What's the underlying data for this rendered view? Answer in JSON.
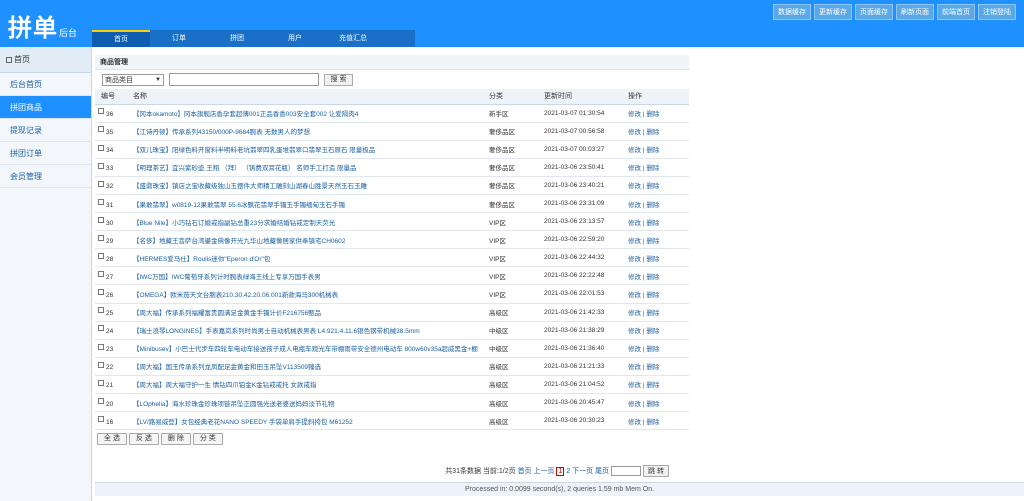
{
  "brand": {
    "logo_big": "拼单",
    "logo_small": "后台"
  },
  "quick_links": [
    "数据缓存",
    "更新缓存",
    "页面缓存",
    "刷新页面",
    "前端首页",
    "注销登陆"
  ],
  "main_nav": [
    {
      "label": "首页",
      "active": true
    },
    {
      "label": "订单",
      "active": false
    },
    {
      "label": "拼团",
      "active": false
    },
    {
      "label": "用户",
      "active": false
    },
    {
      "label": "充值汇总",
      "active": false
    }
  ],
  "sidebar": {
    "title": "首页",
    "items": [
      {
        "label": "后台首页",
        "active": false
      },
      {
        "label": "拼团商品",
        "active": true
      },
      {
        "label": "提现记录",
        "active": false
      },
      {
        "label": "拼团订单",
        "active": false
      },
      {
        "label": "会员管理",
        "active": false
      }
    ]
  },
  "panel": {
    "title": "商品管理",
    "category_select": "商品类目",
    "search_button": "搜 索",
    "headers": [
      "编号",
      "名称",
      "分类",
      "更新时间",
      "操作"
    ],
    "edit_label": "修改",
    "sep": "|",
    "delete_label": "删除",
    "rows": [
      {
        "id": "36",
        "name": "【冈本okamoto】冈本旗舰店香孕套超薄001正品香香003安全套002 让爱隔肉4",
        "cat": "新手区",
        "time": "2021-03-07 01:30:54"
      },
      {
        "id": "35",
        "name": "【江诗丹顿】传承系列43150/000P-9684腕表 无数男人的梦想",
        "cat": "奢侈品区",
        "time": "2021-03-07 00:56:58"
      },
      {
        "id": "34",
        "name": "【双儿珠宝】阳绿色料开窗料半明料老坑翡翠四乳蛋堆翡翠口翡翠玉石原石 限量极品",
        "cat": "奢侈品区",
        "time": "2021-03-07 00:03:27"
      },
      {
        "id": "33",
        "name": "【明理茶艺】宜兴紫砂壶 王翔 （拜） （铸费双耳花瓶） 名师手工打造 限量品",
        "cat": "奢侈品区",
        "time": "2021-03-06 23:50:41"
      },
      {
        "id": "32",
        "name": "【盛鼎珠宝】镇店之宝收藏级独山玉摆件大师精工雕刻山湖春山胜景天然玉石玉雕",
        "cat": "奢侈品区",
        "time": "2021-03-06 23:40:21"
      },
      {
        "id": "31",
        "name": "【果敢翡翠】w0819-12果敢翡翠 55.6冰飘花翡翠手镯玉手镯缅甸玉石手镯",
        "cat": "奢侈品区",
        "time": "2021-03-06 23:31:09"
      },
      {
        "id": "30",
        "name": "【Blue Nile】小巧钻石订婚戒指副钻总重23分求婚结婚钻戒定制天荧光",
        "cat": "VIP区",
        "time": "2021-03-06 23:13:57"
      },
      {
        "id": "29",
        "name": "【名侈】地藏王菩萨台湾鎏金佛像开光九华山地藏像居家供奉镇宅CH0602",
        "cat": "VIP区",
        "time": "2021-03-06 22:59:20"
      },
      {
        "id": "28",
        "name": "【HERMES爱马仕】Roulis迷你\"Eperon d'Or\"包",
        "cat": "VIP区",
        "time": "2021-03-06 22:44:32"
      },
      {
        "id": "27",
        "name": "【IWC万国】IWC葡萄牙系列计时腕表绿海王线上专享万国手表男",
        "cat": "VIP区",
        "time": "2021-03-06 22:22:48"
      },
      {
        "id": "26",
        "name": "【OMEGA】欧米茄天文台腕表210.30.42.20.06.001新款海马300机械表",
        "cat": "VIP区",
        "time": "2021-03-06 22:01:53"
      },
      {
        "id": "25",
        "name": "【周大福】传承系列福耀富贵圆满足金黄金手镯计价F216756甄品",
        "cat": "高级区",
        "time": "2021-03-06 21:42:33"
      },
      {
        "id": "24",
        "name": "【瑞士浪琴LONGINES】手表嘉岚系列时尚男士自动机械表男表 L4.921.4.11.6银色钢带机械38.5mm",
        "cat": "中级区",
        "time": "2021-03-06 21:38:29"
      },
      {
        "id": "23",
        "name": "【Minibusev】小巴士代步车四轮车电动车接送孩子成人电瓶车观光车带棚雨带安全德州电动车 800w60v35a超威黑金+棚",
        "cat": "中级区",
        "time": "2021-03-06 21:36:40"
      },
      {
        "id": "22",
        "name": "【周大福】国玉传承系列龙凤配足金黄金和田玉吊坠V113509臻选",
        "cat": "高级区",
        "time": "2021-03-06 21:21:33"
      },
      {
        "id": "21",
        "name": "【周大福】周大福守护一生 情钻四爪铂金K金钻戒戒托 女款戒指",
        "cat": "高级区",
        "time": "2021-03-06 21:04:52"
      },
      {
        "id": "20",
        "name": "【LOphelia】海水珍珠金珍珠项链吊坠正圆强光送老婆送妈妈淡节礼物",
        "cat": "高级区",
        "time": "2021-03-06 20:45:47"
      },
      {
        "id": "16",
        "name": "【LV/路易威登】女包经典老花NANO SPEEDY 手袋单肩手提斜挎包 M61252",
        "cat": "高级区",
        "time": "2021-03-06 20:30:23"
      }
    ],
    "bulk_buttons": [
      "全 选",
      "反 选",
      "删 除",
      "分 类"
    ]
  },
  "pager": {
    "summary": "共31条数据 当前:1/2页",
    "first": "首页",
    "prev": "上一页",
    "current": "1",
    "page2": "2",
    "next": "下一页",
    "last": "尾页",
    "jump_label": "跳 转"
  },
  "footer": "Processed in: 0.0099 second(s), 2 queries 1.59 mb Mem On."
}
